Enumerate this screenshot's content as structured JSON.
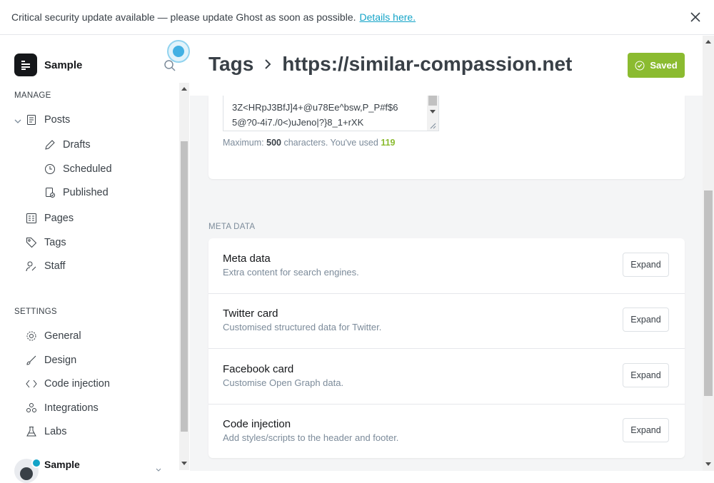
{
  "banner": {
    "message": "Critical security update available — please update Ghost as soon as possible.",
    "link": "Details here."
  },
  "sidebar": {
    "site_name": "Sample",
    "manage_label": "MANAGE",
    "settings_label": "SETTINGS",
    "manage_items": [
      {
        "label": "Posts",
        "icon": "posts-icon"
      },
      {
        "label": "Drafts",
        "icon": "pencil-icon"
      },
      {
        "label": "Scheduled",
        "icon": "clock-icon"
      },
      {
        "label": "Published",
        "icon": "published-icon"
      },
      {
        "label": "Pages",
        "icon": "pages-icon"
      },
      {
        "label": "Tags",
        "icon": "tag-icon"
      },
      {
        "label": "Staff",
        "icon": "staff-icon"
      }
    ],
    "settings_items": [
      {
        "label": "General",
        "icon": "gear-icon"
      },
      {
        "label": "Design",
        "icon": "brush-icon"
      },
      {
        "label": "Code injection",
        "icon": "code-icon"
      },
      {
        "label": "Integrations",
        "icon": "integrations-icon"
      },
      {
        "label": "Labs",
        "icon": "flask-icon"
      }
    ],
    "user_name": "Sample"
  },
  "header": {
    "breadcrumb_parent": "Tags",
    "breadcrumb_current": "https://similar-compassion.net",
    "saved_label": "Saved"
  },
  "description_field": {
    "value": "3Z<HRpJ3BfJ]4+@u78Ee^bsw,P_P#f$6\n5@?0-4i7./0<)uJeno|?}8_1+rXK",
    "help_prefix": "Maximum:",
    "max": "500",
    "help_middle": "characters. You've used",
    "used": "119"
  },
  "meta_section": {
    "label": "META DATA",
    "rows": [
      {
        "title": "Meta data",
        "desc": "Extra content for search engines.",
        "button": "Expand"
      },
      {
        "title": "Twitter card",
        "desc": "Customised structured data for Twitter.",
        "button": "Expand"
      },
      {
        "title": "Facebook card",
        "desc": "Customise Open Graph data.",
        "button": "Expand"
      },
      {
        "title": "Code injection",
        "desc": "Add styles/scripts to the header and footer.",
        "button": "Expand"
      }
    ]
  },
  "colors": {
    "accent_green": "#8bbb30",
    "link_blue": "#14a4c8"
  }
}
